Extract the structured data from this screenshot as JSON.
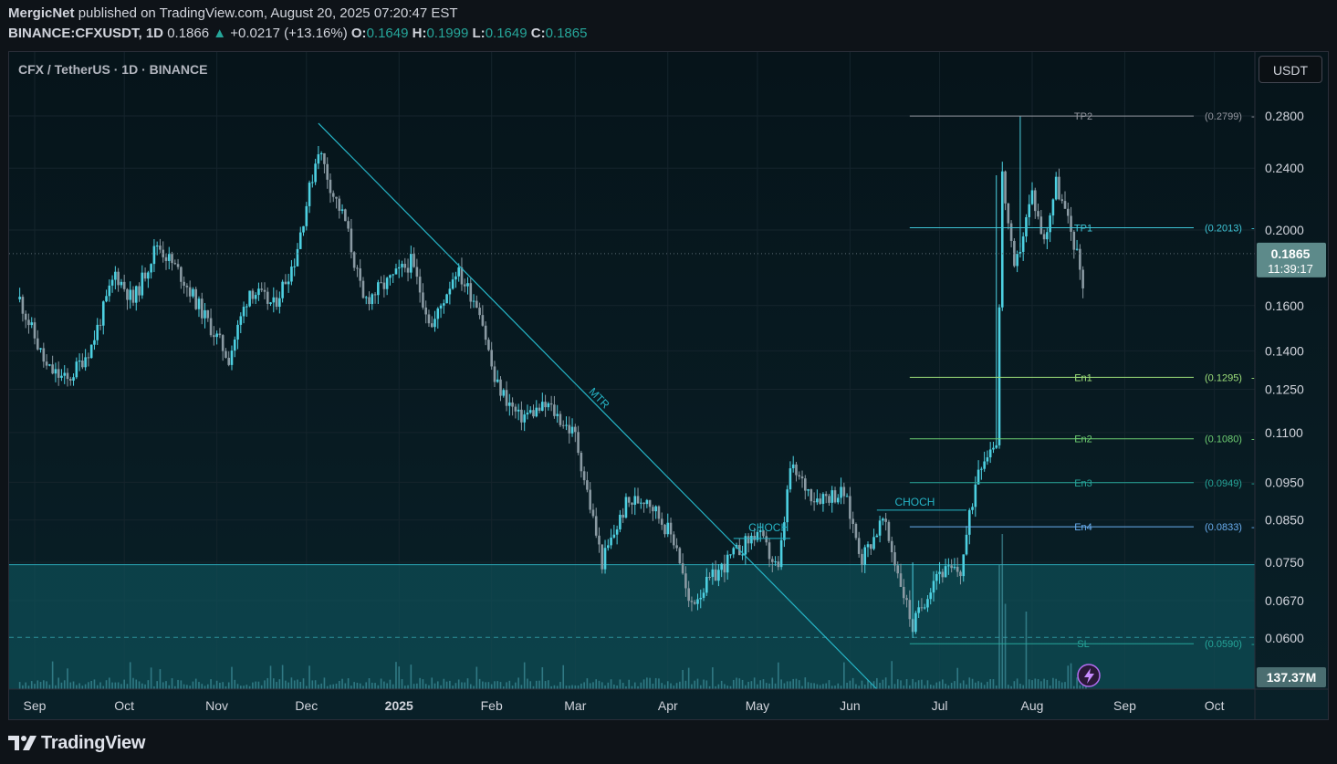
{
  "header": {
    "publisher": "MergicNet",
    "published_text": "published on TradingView.com, August 20, 2025 07:20:47 EST",
    "symbol": "BINANCE:CFXUSDT, 1D",
    "last": "0.1866",
    "change_arrow": "▲",
    "change": "+0.0217 (+13.16%)",
    "o_label": "O:",
    "o_value": "0.1649",
    "h_label": "H:",
    "h_value": "0.1999",
    "l_label": "L:",
    "l_value": "0.1649",
    "c_label": "C:",
    "c_value": "0.1865"
  },
  "chart": {
    "symbol_title": "CFX / TetherUS · 1D · BINANCE",
    "currency": "USDT",
    "price_label": "0.1865",
    "countdown": "11:39:17",
    "volume_label": "137.37M"
  },
  "chart_data": {
    "type": "candlestick",
    "y_scale": "log",
    "y_ticks": [
      "0.2800",
      "0.2400",
      "0.2000",
      "0.1600",
      "0.1400",
      "0.1250",
      "0.1100",
      "0.0950",
      "0.0850",
      "0.0750",
      "0.0670",
      "0.0600"
    ],
    "x_ticks": [
      "Sep",
      "Oct",
      "Nov",
      "Dec",
      "2025",
      "Feb",
      "Mar",
      "Apr",
      "May",
      "Jun",
      "Jul",
      "Aug",
      "Sep",
      "Oct"
    ],
    "bold_x_ticks": [
      "2025"
    ],
    "levels": [
      {
        "label": "TP2",
        "value": "(0.2799)",
        "price": 0.2799,
        "color": "#9598a1"
      },
      {
        "label": "TP1",
        "value": "(0.2013)",
        "price": 0.2013,
        "color": "#3ec6d8"
      },
      {
        "label": "En1",
        "value": "(0.1295)",
        "price": 0.1295,
        "color": "#9ee07a"
      },
      {
        "label": "En2",
        "value": "(0.1080)",
        "price": 0.108,
        "color": "#6fcf72"
      },
      {
        "label": "En3",
        "value": "(0.0949)",
        "price": 0.0949,
        "color": "#26a69a"
      },
      {
        "label": "En4",
        "value": "(0.0833)",
        "price": 0.0833,
        "color": "#6aaef0"
      },
      {
        "label": "SL",
        "value": "(0.0590)",
        "price": 0.059,
        "color": "#26a69a"
      }
    ],
    "annotations": [
      {
        "text": "MTR",
        "kind": "trendline"
      },
      {
        "text": "CHOCH",
        "kind": "structure"
      },
      {
        "text": "CHOCH",
        "kind": "structure"
      }
    ],
    "demand_zone": {
      "top": 0.0745,
      "bottom": 0.051
    },
    "trendline": {
      "from": {
        "date": "2024-12-05",
        "price": 0.274
      },
      "to": {
        "date": "2025-06-10",
        "price": 0.051
      }
    },
    "last_price": 0.1865,
    "path": [
      {
        "date": "2024-08-27",
        "price": 0.163
      },
      {
        "date": "2024-09-05",
        "price": 0.133
      },
      {
        "date": "2024-09-12",
        "price": 0.128
      },
      {
        "date": "2024-09-20",
        "price": 0.142
      },
      {
        "date": "2024-09-28",
        "price": 0.176
      },
      {
        "date": "2024-10-04",
        "price": 0.162
      },
      {
        "date": "2024-10-12",
        "price": 0.192
      },
      {
        "date": "2024-10-20",
        "price": 0.175
      },
      {
        "date": "2024-10-30",
        "price": 0.15
      },
      {
        "date": "2024-11-05",
        "price": 0.137
      },
      {
        "date": "2024-11-12",
        "price": 0.168
      },
      {
        "date": "2024-11-20",
        "price": 0.16
      },
      {
        "date": "2024-11-27",
        "price": 0.183
      },
      {
        "date": "2024-12-05",
        "price": 0.255
      },
      {
        "date": "2024-12-10",
        "price": 0.222
      },
      {
        "date": "2024-12-14",
        "price": 0.205
      },
      {
        "date": "2024-12-20",
        "price": 0.162
      },
      {
        "date": "2024-12-28",
        "price": 0.171
      },
      {
        "date": "2025-01-05",
        "price": 0.182
      },
      {
        "date": "2025-01-12",
        "price": 0.15
      },
      {
        "date": "2025-01-20",
        "price": 0.178
      },
      {
        "date": "2025-01-28",
        "price": 0.159
      },
      {
        "date": "2025-02-02",
        "price": 0.128
      },
      {
        "date": "2025-02-10",
        "price": 0.115
      },
      {
        "date": "2025-02-20",
        "price": 0.119
      },
      {
        "date": "2025-03-01",
        "price": 0.109
      },
      {
        "date": "2025-03-10",
        "price": 0.075
      },
      {
        "date": "2025-03-18",
        "price": 0.089
      },
      {
        "date": "2025-03-25",
        "price": 0.091
      },
      {
        "date": "2025-04-04",
        "price": 0.079
      },
      {
        "date": "2025-04-08",
        "price": 0.066
      },
      {
        "date": "2025-04-15",
        "price": 0.071
      },
      {
        "date": "2025-04-22",
        "price": 0.076
      },
      {
        "date": "2025-05-01",
        "price": 0.082
      },
      {
        "date": "2025-05-08",
        "price": 0.073
      },
      {
        "date": "2025-05-12",
        "price": 0.099
      },
      {
        "date": "2025-05-20",
        "price": 0.091
      },
      {
        "date": "2025-05-30",
        "price": 0.092
      },
      {
        "date": "2025-06-05",
        "price": 0.076
      },
      {
        "date": "2025-06-12",
        "price": 0.085
      },
      {
        "date": "2025-06-17",
        "price": 0.073
      },
      {
        "date": "2025-06-22",
        "price": 0.062
      },
      {
        "date": "2025-06-30",
        "price": 0.073
      },
      {
        "date": "2025-07-08",
        "price": 0.073
      },
      {
        "date": "2025-07-14",
        "price": 0.1
      },
      {
        "date": "2025-07-20",
        "price": 0.108
      },
      {
        "date": "2025-07-22",
        "price": 0.235
      },
      {
        "date": "2025-07-26",
        "price": 0.176
      },
      {
        "date": "2025-08-01",
        "price": 0.223
      },
      {
        "date": "2025-08-05",
        "price": 0.193
      },
      {
        "date": "2025-08-09",
        "price": 0.23
      },
      {
        "date": "2025-08-15",
        "price": 0.193
      },
      {
        "date": "2025-08-19",
        "price": 0.165
      }
    ],
    "volume_spikes": [
      {
        "date": "2025-07-21",
        "relative": 0.8
      },
      {
        "date": "2025-07-22",
        "relative": 1.0
      },
      {
        "date": "2025-07-23",
        "relative": 0.55
      },
      {
        "date": "2025-07-30",
        "relative": 0.5
      }
    ]
  },
  "footer": {
    "brand": "TradingView"
  },
  "colors": {
    "up": "#4dd0e1",
    "down": "#8a9aa3",
    "trendline": "#26b5c7",
    "zone": "#0e5c66",
    "grid": "#15242c",
    "axis_text": "#d1d4dc"
  }
}
